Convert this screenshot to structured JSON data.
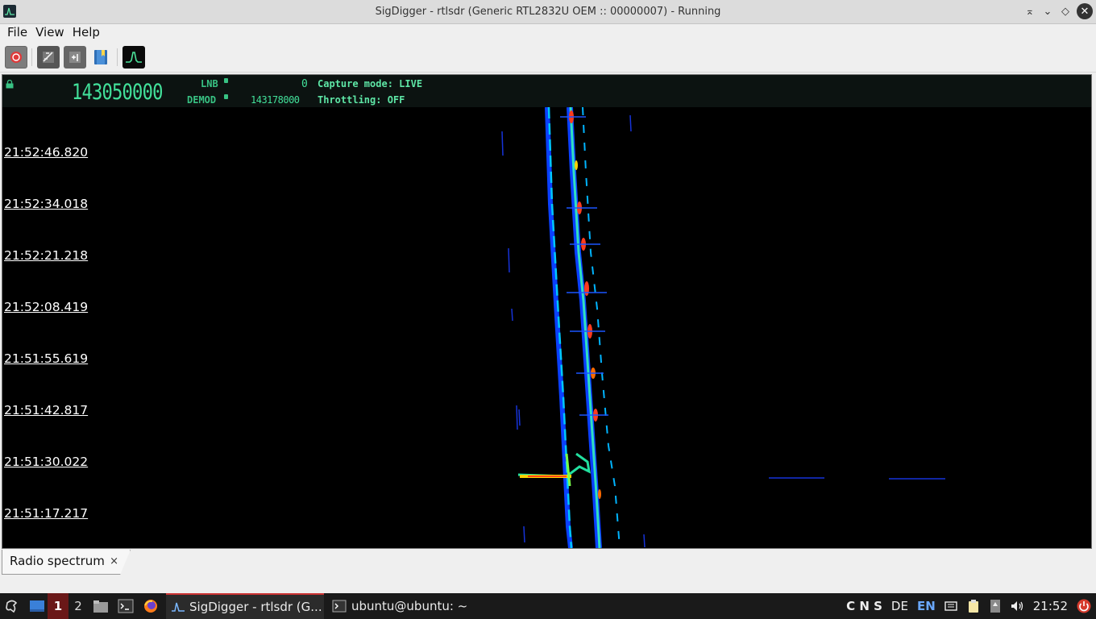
{
  "window": {
    "title": "SigDigger - rtlsdr (Generic RTL2832U OEM :: 00000007) - Running"
  },
  "menu": [
    "File",
    "View",
    "Help"
  ],
  "toolbar": {
    "icons": [
      "record-icon",
      "settings-icon",
      "add-source-icon",
      "bookmark-icon",
      "spectrum-icon"
    ]
  },
  "header": {
    "frequency": "143050000",
    "lnb_label": "LNB",
    "lnb_value": "0",
    "demod_label": "DEMOD",
    "demod_value": "143178000",
    "capture_mode": "Capture mode: LIVE",
    "throttling": "Throttling: OFF"
  },
  "waterfall": {
    "timestamps": [
      "21:52:46.820",
      "21:52:34.018",
      "21:52:21.218",
      "21:52:08.419",
      "21:51:55.619",
      "21:51:42.817",
      "21:51:30.022",
      "21:51:17.217"
    ]
  },
  "tabs": [
    {
      "label": "Radio spectrum",
      "close": "×"
    }
  ],
  "taskbar": {
    "workspace_active": "1",
    "workspace_other": "2",
    "task_active": "SigDigger - rtlsdr (G...",
    "task_terminal": "ubuntu@ubuntu: ~",
    "tray_cns": "C N S",
    "tray_de": "DE",
    "tray_en": "EN",
    "clock": "21:52"
  },
  "colors": {
    "freq_green": "#42e09a",
    "waterfall_bg": "#000000",
    "active_workspace": "#6a1818"
  }
}
